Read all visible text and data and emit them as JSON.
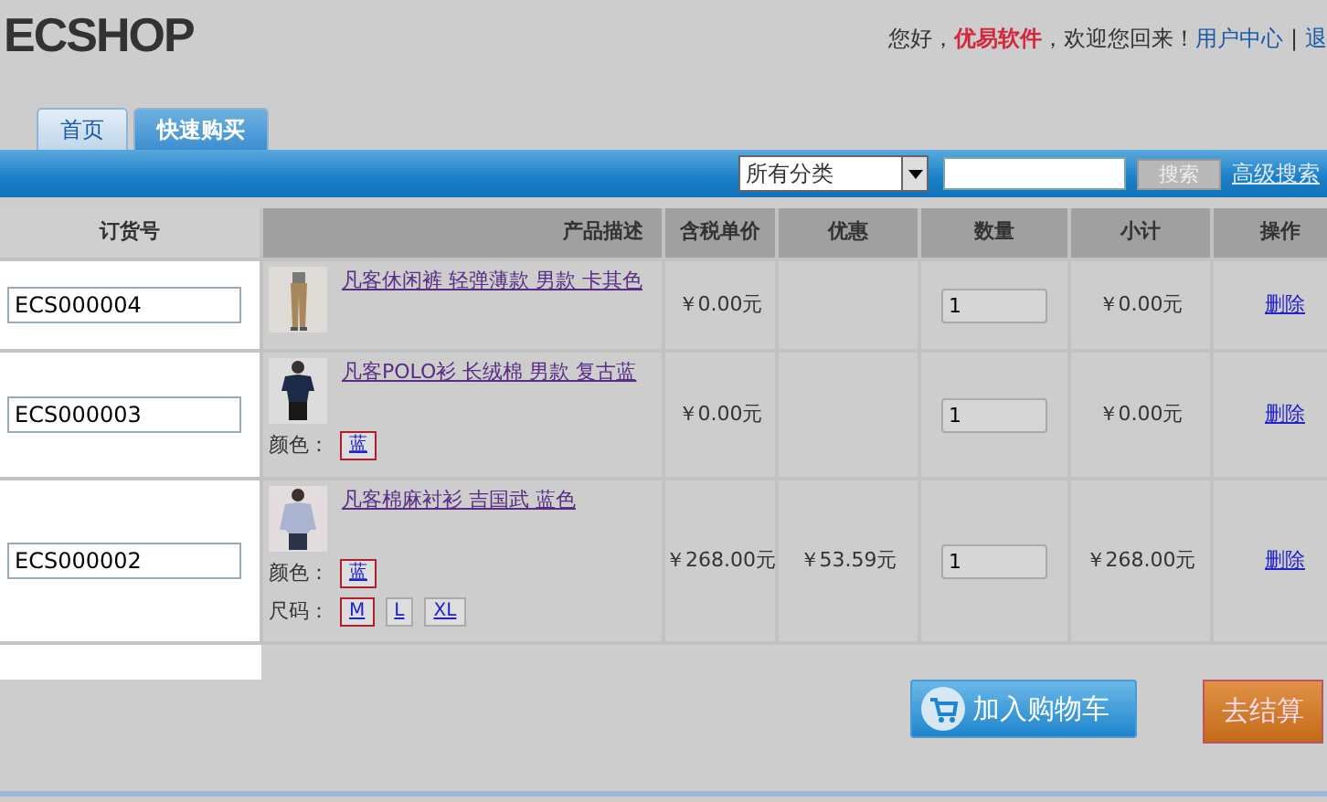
{
  "header": {
    "logo": "ECSHOP",
    "greeting": "您好，",
    "user": "优易软件",
    "welcome": "，欢迎您回来！",
    "user_center": "用户中心",
    "separator": "|",
    "logout": "退"
  },
  "tabs": [
    {
      "label": "首页",
      "selected": false
    },
    {
      "label": "快速购买",
      "selected": true
    }
  ],
  "search": {
    "category": "所有分类",
    "button": "搜索",
    "advanced": "高级搜索"
  },
  "table": {
    "columns": [
      "订货号",
      "产品描述",
      "含税单价",
      "优惠",
      "数量",
      "小计",
      "操作"
    ],
    "rows": [
      {
        "order_no": "ECS000004",
        "title": "凡客休闲裤 轻弹薄款 男款 卡其色",
        "kind": "pants",
        "options": [],
        "price": "￥0.00元",
        "qty": "1",
        "subtotal": "￥0.00元",
        "action": "删除"
      },
      {
        "order_no": "ECS000003",
        "title": "凡客POLO衫 长绒棉 男款 复古蓝",
        "kind": "polo",
        "options": [
          {
            "label": "颜色：",
            "values": [
              {
                "text": "蓝",
                "selected": true
              }
            ]
          }
        ],
        "price": "￥0.00元",
        "qty": "1",
        "subtotal": "￥0.00元",
        "action": "删除"
      },
      {
        "order_no": "ECS000002",
        "title": "凡客棉麻衬衫 吉国武 蓝色",
        "kind": "shirt",
        "options": [
          {
            "label": "颜色：",
            "values": [
              {
                "text": "蓝",
                "selected": true
              }
            ]
          },
          {
            "label": "尺码：",
            "values": [
              {
                "text": "M",
                "selected": true
              },
              {
                "text": "L",
                "selected": false
              },
              {
                "text": "XL",
                "selected": false
              }
            ]
          }
        ],
        "price": "￥268.00元",
        "discount": "￥53.59元",
        "qty": "1",
        "subtotal": "￥268.00元",
        "action": "删除"
      }
    ]
  },
  "buttons": {
    "add_to_cart": "加入购物车",
    "checkout": "去结算"
  }
}
